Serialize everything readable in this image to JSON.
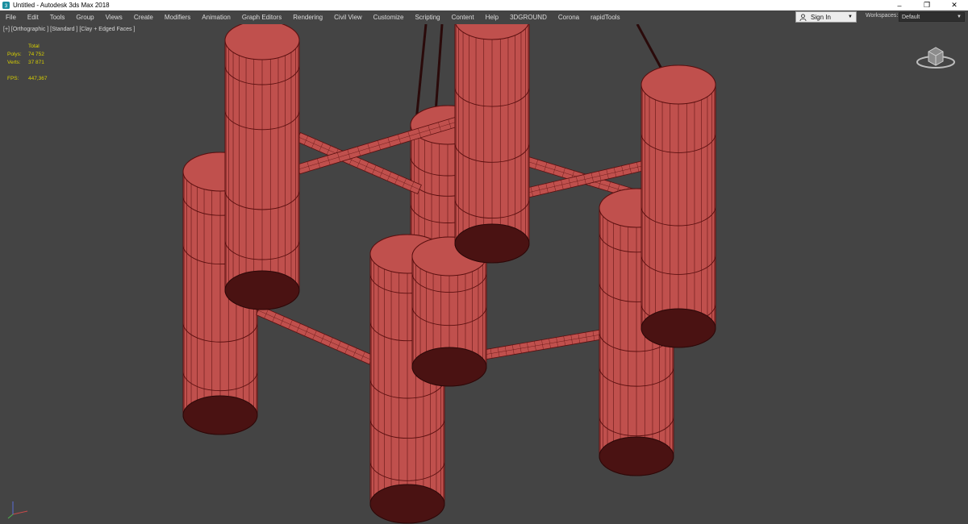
{
  "window": {
    "title": "Untitled - Autodesk 3ds Max 2018"
  },
  "menu": [
    "File",
    "Edit",
    "Tools",
    "Group",
    "Views",
    "Create",
    "Modifiers",
    "Animation",
    "Graph Editors",
    "Rendering",
    "Civil View",
    "Customize",
    "Scripting",
    "Content",
    "Help",
    "3DGROUND",
    "Corona",
    "rapidTools"
  ],
  "signin": {
    "label": "Sign In"
  },
  "workspaces": {
    "label": "Workspaces:",
    "value": "Default"
  },
  "viewport": {
    "label": "[+] [Orthographic ] [Standard ] [Clay + Edged Faces ]"
  },
  "stats": {
    "header": "Total",
    "polys_label": "Polys:",
    "polys_value": "74 752",
    "verts_label": "Verts:",
    "verts_value": "37 871",
    "fps_label": "FPS:",
    "fps_value": "447,367"
  },
  "colors": {
    "viewport_bg": "#444444",
    "mesh": "#c0504d",
    "wire": "#5a1010",
    "cap": "#4a1212",
    "stats": "#d8d000"
  },
  "icons": {
    "app": "3dsmax-icon",
    "user": "user-icon",
    "viewcube": "viewcube-icon",
    "axis": "axis-tripod-icon"
  }
}
